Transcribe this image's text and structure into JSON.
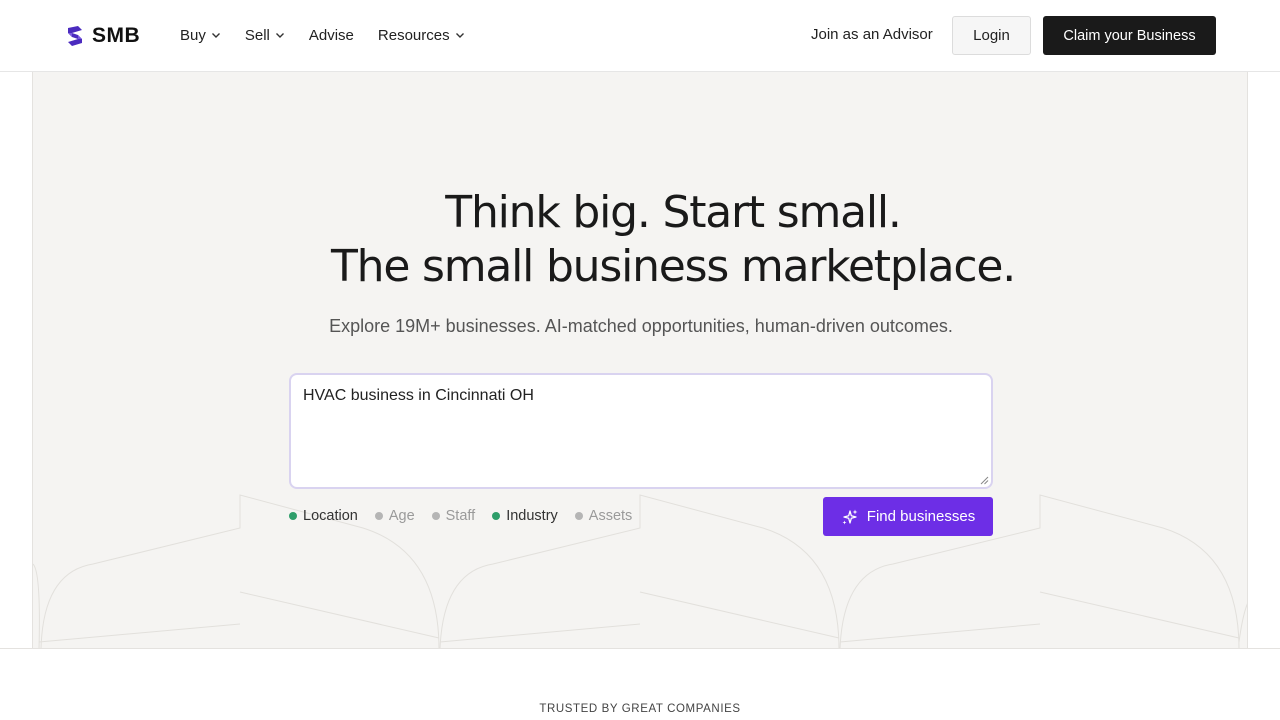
{
  "header": {
    "logo_text": "SMB",
    "brand_color": "#4b2bbf",
    "nav": [
      {
        "label": "Buy",
        "has_dropdown": true
      },
      {
        "label": "Sell",
        "has_dropdown": true
      },
      {
        "label": "Advise",
        "has_dropdown": false
      },
      {
        "label": "Resources",
        "has_dropdown": true
      }
    ],
    "join_label": "Join as an Advisor",
    "login_label": "Login",
    "claim_label": "Claim your Business"
  },
  "hero": {
    "headline_line1": "Think big. Start small.",
    "headline_line2": "The small business marketplace.",
    "subhead": "Explore 19M+ businesses. AI-matched opportunities, human-driven outcomes.",
    "search": {
      "value": "HVAC business in Cincinnati OH"
    },
    "criteria": [
      {
        "label": "Location",
        "matched": true
      },
      {
        "label": "Age",
        "matched": false
      },
      {
        "label": "Staff",
        "matched": false
      },
      {
        "label": "Industry",
        "matched": true
      },
      {
        "label": "Assets",
        "matched": false
      }
    ],
    "matched_color": "#2e9e6a",
    "unmatched_color": "#b5b5b5",
    "find_label": "Find businesses",
    "find_icon": "sparkles-icon",
    "accent_color": "#6d2ee6"
  },
  "trusted_label": "TRUSTED BY GREAT COMPANIES"
}
